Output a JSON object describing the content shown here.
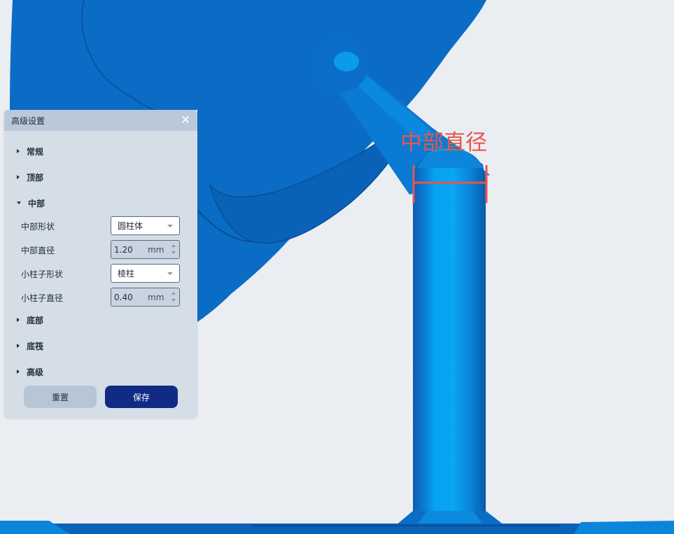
{
  "viewport": {
    "annotation_label": "中部直径",
    "colors": {
      "background": "#eaeef2",
      "model_blue": "#0a70c8",
      "support_blue": "#0095e6",
      "annotation_red": "#e8554e"
    }
  },
  "panel": {
    "title": "高级设置",
    "close_icon": "close-icon",
    "sections": {
      "general": "常规",
      "top": "顶部",
      "middle": "中部",
      "bottom": "底部",
      "raft": "底筏",
      "advanced": "高级"
    },
    "middle": {
      "shape_label": "中部形状",
      "shape_value": "圆柱体",
      "diameter_label": "中部直径",
      "diameter_value": "1.20",
      "diameter_unit": "mm",
      "pillar_shape_label": "小柱子形状",
      "pillar_shape_value": "棱柱",
      "pillar_diameter_label": "小柱子直径",
      "pillar_diameter_value": "0.40",
      "pillar_diameter_unit": "mm"
    },
    "buttons": {
      "reset": "重置",
      "save": "保存"
    }
  }
}
